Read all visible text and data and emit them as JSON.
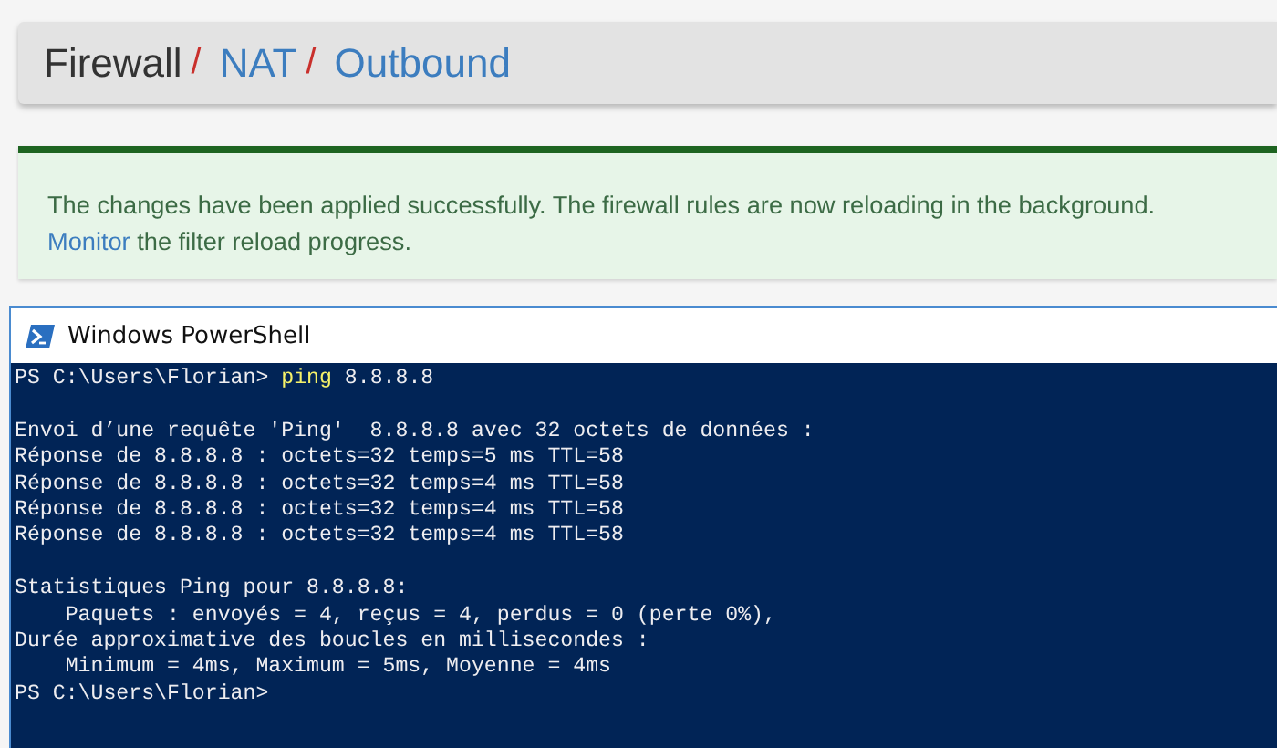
{
  "breadcrumb": [
    {
      "label": "Firewall",
      "kind": "current"
    },
    {
      "label": "/",
      "kind": "separator"
    },
    {
      "label": "NAT",
      "kind": "link"
    },
    {
      "label": "/",
      "kind": "separator"
    },
    {
      "label": "Outbound",
      "kind": "link"
    }
  ],
  "alert": {
    "text": "The changes have been applied successfully. The firewall rules are now reloading in the background.",
    "link": "Monitor",
    "text_after": "the filter reload progress."
  },
  "window": {
    "title": "Windows PowerShell"
  },
  "console": [
    {
      "kind": "prompt",
      "prompt": "PS C:\\Users\\Florian>",
      "command": "ping",
      "argument": "8.8.8.8"
    },
    {
      "kind": "blank"
    },
    {
      "kind": "text",
      "text": "Envoi d’une requête 'Ping'  8.8.8.8 avec 32 octets de données :"
    },
    {
      "kind": "text",
      "text": "Réponse de 8.8.8.8 : octets=32 temps=5 ms TTL=58"
    },
    {
      "kind": "text",
      "text": "Réponse de 8.8.8.8 : octets=32 temps=4 ms TTL=58"
    },
    {
      "kind": "text",
      "text": "Réponse de 8.8.8.8 : octets=32 temps=4 ms TTL=58"
    },
    {
      "kind": "text",
      "text": "Réponse de 8.8.8.8 : octets=32 temps=4 ms TTL=58"
    },
    {
      "kind": "blank"
    },
    {
      "kind": "text",
      "text": "Statistiques Ping pour 8.8.8.8:"
    },
    {
      "kind": "text",
      "text": "    Paquets : envoyés = 4, reçus = 4, perdus = 0 (perte 0%),"
    },
    {
      "kind": "text",
      "text": "Durée approximative des boucles en millisecondes :"
    },
    {
      "kind": "text",
      "text": "    Minimum = 4ms, Maximum = 5ms, Moyenne = 4ms"
    },
    {
      "kind": "prompt",
      "prompt": "PS C:\\Users\\Florian>"
    }
  ]
}
